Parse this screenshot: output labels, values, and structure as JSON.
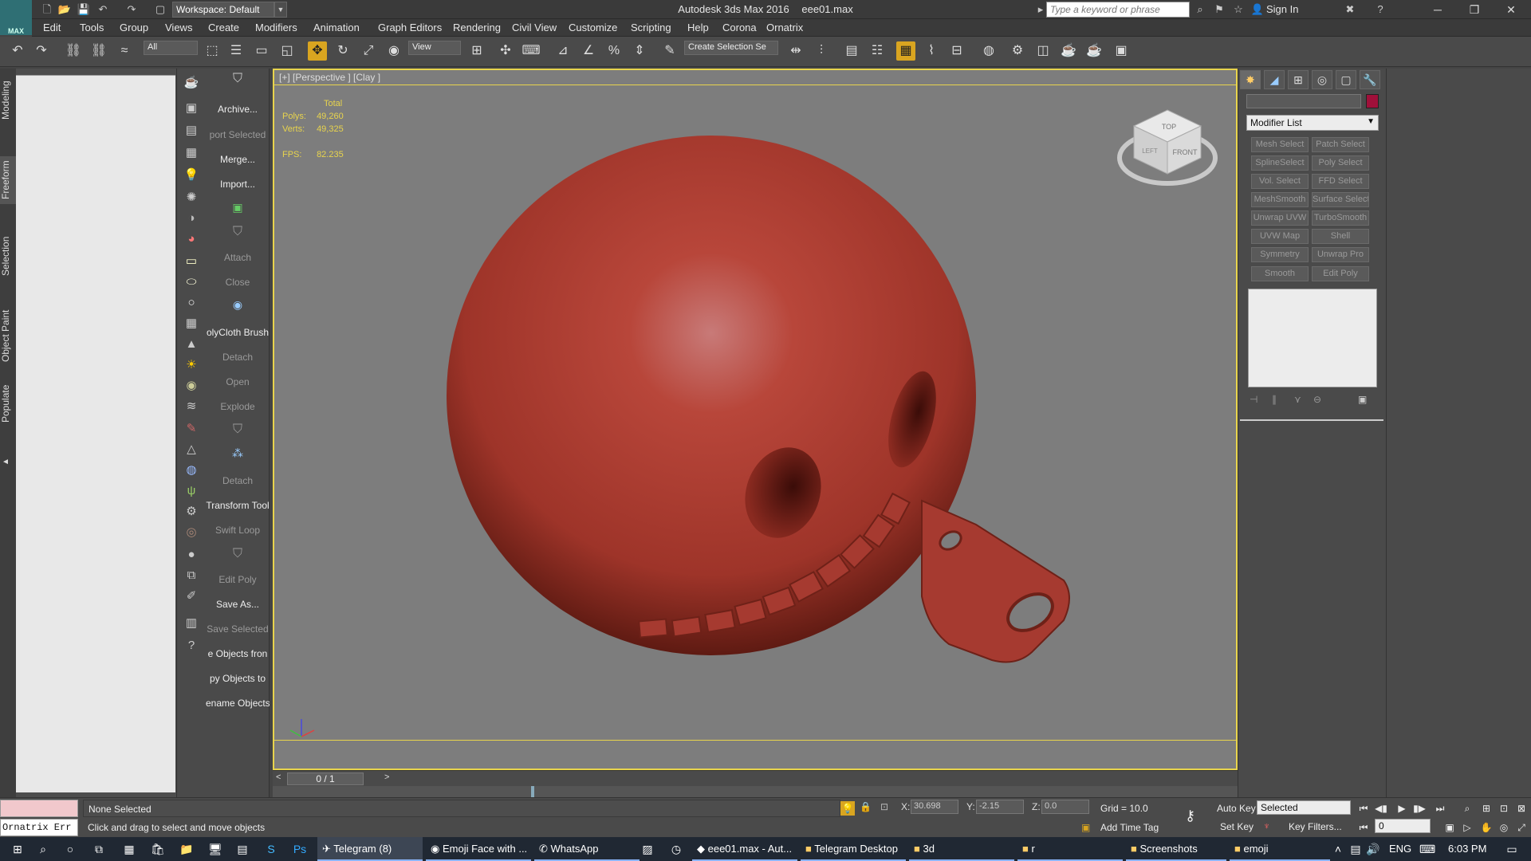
{
  "titlebar": {
    "logo": "MAX",
    "workspace": "Workspace: Default",
    "app_name": "Autodesk 3ds Max 2016",
    "file_name": "eee01.max",
    "search_placeholder": "Type a keyword or phrase",
    "sign_in": "Sign In"
  },
  "menu": [
    "Edit",
    "Tools",
    "Group",
    "Views",
    "Create",
    "Modifiers",
    "Animation",
    "Graph Editors",
    "Rendering",
    "Civil View",
    "Customize",
    "Scripting",
    "Help",
    "Corona",
    "Ornatrix"
  ],
  "toolbar": {
    "filter": "All",
    "ref_coord": "View",
    "selection_set_placeholder": "Create Selection Se"
  },
  "left_tabs": [
    "Modeling",
    "Freeform",
    "Selection",
    "Object Paint",
    "Populate"
  ],
  "command_buttons": [
    {
      "label": "Archive...",
      "dim": false
    },
    {
      "label": "port Selected",
      "dim": true
    },
    {
      "label": "Merge...",
      "dim": false
    },
    {
      "label": "Import...",
      "dim": false
    },
    {
      "label": "",
      "dim": true
    },
    {
      "label": "",
      "dim": true
    },
    {
      "label": "Attach",
      "dim": true
    },
    {
      "label": "Close",
      "dim": true
    },
    {
      "label": "",
      "dim": true
    },
    {
      "label": "olyCloth Brush",
      "dim": false
    },
    {
      "label": "Detach",
      "dim": true
    },
    {
      "label": "Open",
      "dim": true
    },
    {
      "label": "Explode",
      "dim": true
    },
    {
      "label": "",
      "dim": true
    },
    {
      "label": "",
      "dim": true
    },
    {
      "label": "Detach",
      "dim": true
    },
    {
      "label": "Transform Tool",
      "dim": false
    },
    {
      "label": "Swift Loop",
      "dim": true
    },
    {
      "label": "",
      "dim": true
    },
    {
      "label": "Edit Poly",
      "dim": true
    },
    {
      "label": "Save As...",
      "dim": false
    },
    {
      "label": "Save Selected",
      "dim": true
    },
    {
      "label": "e Objects fron",
      "dim": false
    },
    {
      "label": "py Objects to",
      "dim": false
    },
    {
      "label": "ename Objects",
      "dim": false
    }
  ],
  "viewport": {
    "label": "[+] [Perspective ] [Clay ]",
    "stats": {
      "header": "Total",
      "polys_label": "Polys:",
      "polys": "49,260",
      "verts_label": "Verts:",
      "verts": "49,325",
      "fps_label": "FPS:",
      "fps": "82.235"
    },
    "viewcube_top": "TOP",
    "viewcube_front": "FRONT",
    "viewcube_left": "LEFT",
    "object_color": "#b8463a",
    "background_color": "#7d7d7d"
  },
  "timeline": {
    "frame": "0 / 1"
  },
  "command_panel": {
    "modifier_list": "Modifier List",
    "modifiers": [
      "Mesh Select",
      "Patch Select",
      "SplineSelect",
      "Poly Select",
      "Vol. Select",
      "FFD Select",
      "MeshSmooth",
      "Surface Select",
      "Unwrap UVW",
      "TurboSmooth",
      "UVW Map",
      "Shell",
      "Symmetry",
      "Unwrap Pro",
      "Smooth",
      "Edit Poly"
    ],
    "object_color": "#a0103a"
  },
  "status": {
    "selection": "None Selected",
    "prompt": "Click and drag to select and move objects",
    "maxscript": "Ornatrix Err",
    "x_label": "X:",
    "x": "30.698",
    "y_label": "Y:",
    "y": "-2.15",
    "z_label": "Z:",
    "z": "0.0",
    "grid": "Grid = 10.0",
    "add_time_tag": "Add Time Tag",
    "auto_key": "Auto Key",
    "set_key": "Set Key",
    "selected": "Selected",
    "key_filters": "Key Filters...",
    "frame": "0"
  },
  "taskbar": {
    "items": [
      "Telegram (8)",
      "Emoji Face with ...",
      "WhatsApp",
      "eee01.max - Aut...",
      "Telegram Desktop",
      "3d",
      "r",
      "Screenshots",
      "emoji"
    ],
    "lang": "ENG",
    "time": "6:03 PM"
  }
}
